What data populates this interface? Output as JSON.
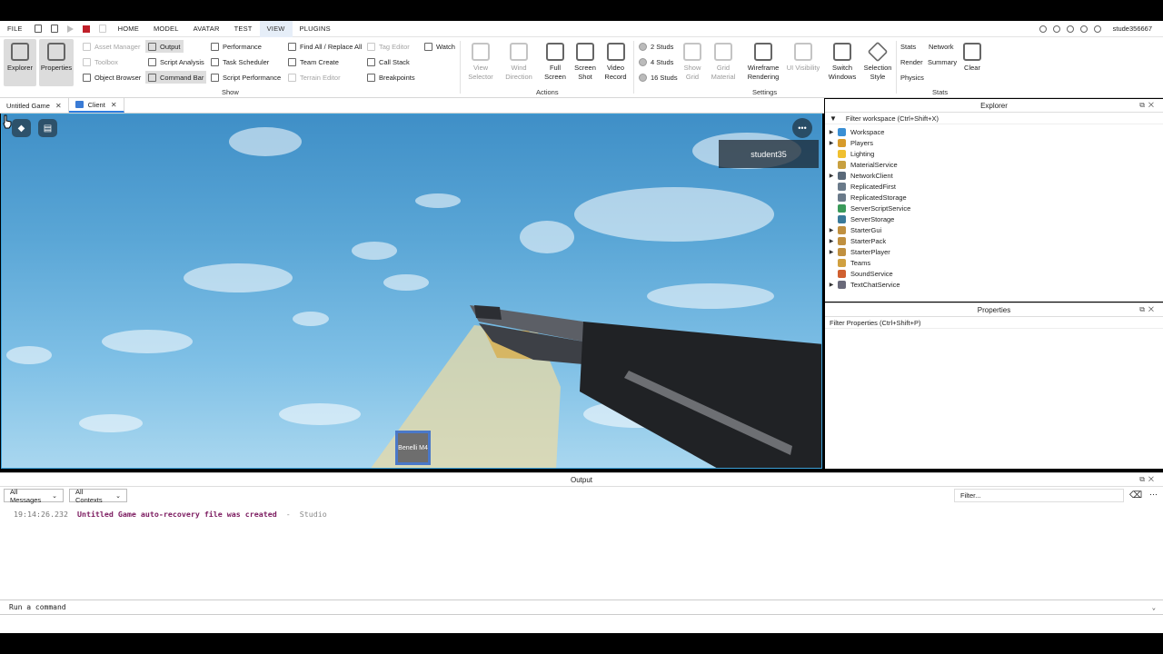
{
  "menubar": {
    "items": [
      "FILE",
      "HOME",
      "MODEL",
      "AVATAR",
      "TEST",
      "VIEW",
      "PLUGINS"
    ],
    "active": "VIEW",
    "username": "stude356667"
  },
  "ribbon": {
    "show": {
      "label": "Show",
      "explorer": "Explorer",
      "properties": "Properties",
      "asset_manager": "Asset Manager",
      "toolbox": "Toolbox",
      "object_browser": "Object Browser",
      "output": "Output",
      "script_analysis": "Script Analysis",
      "command_bar": "Command Bar",
      "performance": "Performance",
      "task_scheduler": "Task Scheduler",
      "script_performance": "Script Performance",
      "find_all": "Find All / Replace All",
      "team_create": "Team Create",
      "terrain_editor": "Terrain Editor",
      "tag_editor": "Tag Editor",
      "call_stack": "Call Stack",
      "breakpoints": "Breakpoints",
      "watch": "Watch"
    },
    "actions": {
      "label": "Actions",
      "view_selector": "View Selector",
      "wind_direction": "Wind Direction",
      "full_screen": "Full Screen",
      "screen_shot": "Screen Shot",
      "video_record": "Video Record"
    },
    "settings": {
      "label": "Settings",
      "studs2": "2 Studs",
      "studs4": "4 Studs",
      "studs16": "16 Studs",
      "show_grid": "Show Grid",
      "grid_material": "Grid Material",
      "wireframe": "Wireframe Rendering",
      "ui_visibility": "UI Visibility",
      "switch_windows": "Switch Windows",
      "selection_style": "Selection Style"
    },
    "stats": {
      "label": "Stats",
      "stats": "Stats",
      "network": "Network",
      "render": "Render",
      "summary": "Summary",
      "physics": "Physics",
      "clear": "Clear"
    }
  },
  "tabs": [
    {
      "label": "Untitled Game"
    },
    {
      "label": "Client"
    }
  ],
  "viewport": {
    "player_name": "student35",
    "hotbar_item": "Benelli M4"
  },
  "explorer": {
    "title": "Explorer",
    "filter": "Filter workspace (Ctrl+Shift+X)",
    "items": [
      {
        "label": "Workspace",
        "expand": true,
        "color": "#3a8fd4"
      },
      {
        "label": "Players",
        "expand": true,
        "color": "#d79b2a"
      },
      {
        "label": "Lighting",
        "expand": false,
        "color": "#f0c030"
      },
      {
        "label": "MaterialService",
        "expand": false,
        "color": "#c8a040"
      },
      {
        "label": "NetworkClient",
        "expand": true,
        "color": "#5a6a7a"
      },
      {
        "label": "ReplicatedFirst",
        "expand": false,
        "color": "#6a7a8a"
      },
      {
        "label": "ReplicatedStorage",
        "expand": false,
        "color": "#6a7a8a"
      },
      {
        "label": "ServerScriptService",
        "expand": false,
        "color": "#3a9a5a"
      },
      {
        "label": "ServerStorage",
        "expand": false,
        "color": "#3a7a9a"
      },
      {
        "label": "StarterGui",
        "expand": true,
        "color": "#c09040"
      },
      {
        "label": "StarterPack",
        "expand": true,
        "color": "#c09040"
      },
      {
        "label": "StarterPlayer",
        "expand": true,
        "color": "#c09040"
      },
      {
        "label": "Teams",
        "expand": false,
        "color": "#d0a040"
      },
      {
        "label": "SoundService",
        "expand": false,
        "color": "#d06030"
      },
      {
        "label": "TextChatService",
        "expand": true,
        "color": "#6a6a7a"
      }
    ]
  },
  "properties": {
    "title": "Properties",
    "filter": "Filter Properties (Ctrl+Shift+P)"
  },
  "output": {
    "title": "Output",
    "messages_select": "All Messages",
    "contexts_select": "All Contexts",
    "filter_placeholder": "Filter...",
    "log": [
      {
        "time": "19:14:26.232",
        "message": "Untitled Game auto-recovery file was created",
        "separator": "-",
        "source": "Studio"
      }
    ]
  },
  "command_bar": {
    "placeholder": "Run a command"
  }
}
